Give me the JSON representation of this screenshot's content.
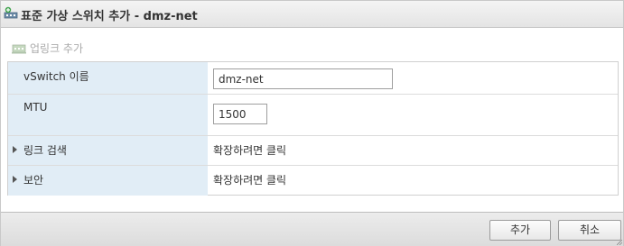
{
  "dialog": {
    "title": "표준 가상 스위치 추가 - dmz-net",
    "title_icon": "virtual-switch-add-icon"
  },
  "toolbar": {
    "add_uplink_label": "업링크 추가",
    "add_uplink_icon": "uplink-add-icon"
  },
  "form": {
    "rows": [
      {
        "label": "vSwitch 이름",
        "value": "dmz-net"
      },
      {
        "label": "MTU",
        "value": "1500"
      },
      {
        "label": "링크 검색",
        "value": "확장하려면 클릭",
        "expandable": true
      },
      {
        "label": "보안",
        "value": "확장하려면 클릭",
        "expandable": true
      }
    ]
  },
  "footer": {
    "add_button": "추가",
    "cancel_button": "취소"
  },
  "colors": {
    "label_background": "#e1edf6",
    "title_bar": "#e8e8e8",
    "footer": "#e2e2e2"
  }
}
